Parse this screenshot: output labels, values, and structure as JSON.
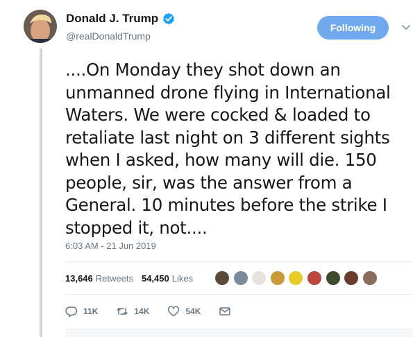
{
  "author": {
    "display_name": "Donald J. Trump",
    "handle": "@realDonaldTrump",
    "verified": true
  },
  "follow_button_label": "Following",
  "tweet": {
    "lines": [
      "....On Monday they shot down an",
      "unmanned drone flying in International",
      "Waters. We were cocked & loaded to",
      "retaliate last night on 3 different sights",
      "when I asked, how many will die. 150",
      "people, sir, was the answer from a",
      "General. 10 minutes before the strike I",
      "stopped it, not...."
    ],
    "timestamp": "6:03 AM - 21 Jun 2019"
  },
  "stats": {
    "retweets_count": "13,646",
    "retweets_label": "Retweets",
    "likes_count": "54,450",
    "likes_label": "Likes"
  },
  "actions": {
    "replies": "11K",
    "retweets": "14K",
    "likes": "54K"
  },
  "colors": {
    "follow_button": "#71a9ef",
    "verified_badge": "#1da1f2",
    "secondary_text": "#657786",
    "thread_line": "#ccd6dd"
  }
}
